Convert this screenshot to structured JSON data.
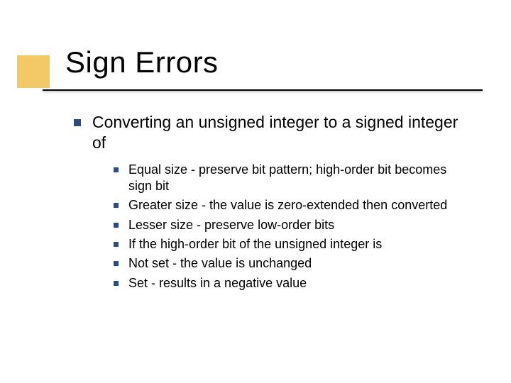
{
  "title": "Sign Errors",
  "bullets": [
    {
      "text": "Converting an unsigned integer to a signed integer of",
      "sub": [
        "Equal size - preserve bit pattern; high-order bit becomes sign bit",
        "Greater size - the value is zero-extended then converted",
        "Lesser size - preserve low-order bits",
        "If the high-order bit of the unsigned integer is",
        "Not set - the value is unchanged",
        "Set - results in a negative value"
      ]
    }
  ]
}
